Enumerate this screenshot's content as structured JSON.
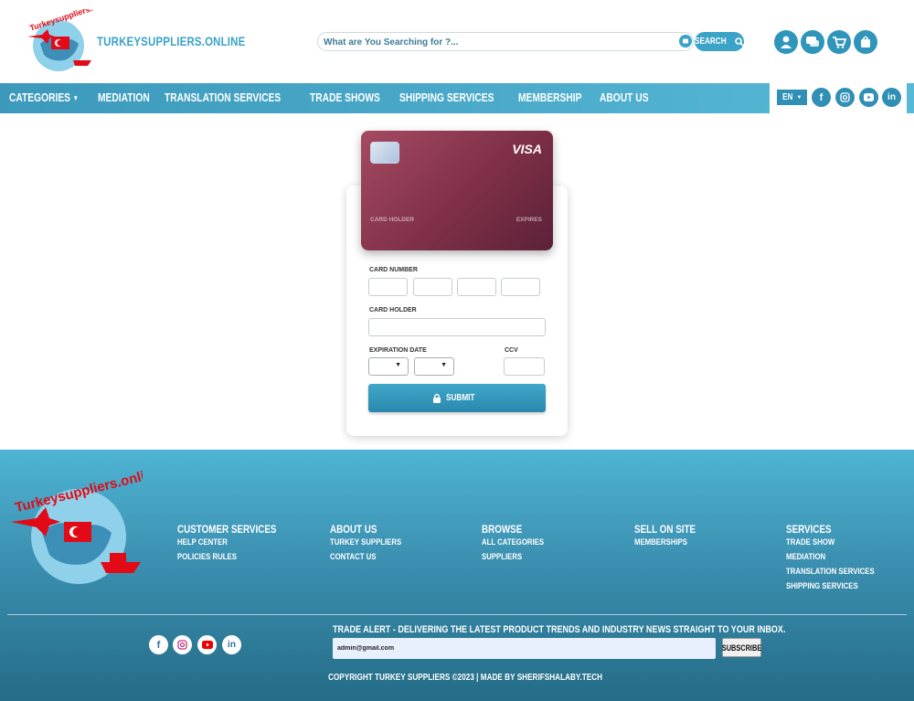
{
  "header": {
    "brand": "TURKEYSUPPLIERS.ONLINE",
    "logo_text": "Turkeysuppliers.online",
    "search_placeholder": "What are You Searching for ?...",
    "search_button": "SEARCH",
    "icons": [
      "user-icon",
      "chat-icon",
      "cart-icon",
      "shopping-bag-icon"
    ]
  },
  "nav": {
    "items": [
      "CATEGORIES",
      "MEDIATION",
      "TRANSLATION SERVICES",
      "TRADE SHOWS",
      "SHIPPING SERVICES",
      "MEMBERSHIP",
      "ABOUT US"
    ],
    "language": "EN",
    "social": [
      "facebook-icon",
      "instagram-icon",
      "youtube-icon",
      "linkedin-icon"
    ]
  },
  "card": {
    "brand": "VISA",
    "holder_label": "CARD HOLDER",
    "expires_label": "EXPIRES"
  },
  "form": {
    "card_number_label": "CARD NUMBER",
    "card_holder_label": "CARD HOLDER",
    "expiration_label": "EXPIRATION DATE",
    "ccv_label": "CCV",
    "submit_label": "SUBMIT"
  },
  "footer": {
    "logo_text": "Turkeysuppliers.online",
    "columns": [
      {
        "title": "CUSTOMER SERVICES",
        "links": [
          "HELP CENTER",
          "POLICIES RULES"
        ]
      },
      {
        "title": "ABOUT US",
        "links": [
          "TURKEY SUPPLIERS",
          "CONTACT US"
        ]
      },
      {
        "title": "BROWSE",
        "links": [
          "ALL CATEGORIES",
          "SUPPLIERS"
        ]
      },
      {
        "title": "SELL ON SITE",
        "links": [
          "MEMBERSHIPS"
        ]
      },
      {
        "title": "SERVICES",
        "links": [
          "TRADE SHOW",
          "MEDIATION",
          "TRANSLATION SERVICES",
          "SHIPPING SERVICES"
        ]
      }
    ],
    "trade_alert": "TRADE ALERT - DELIVERING THE LATEST PRODUCT TRENDS AND INDUSTRY NEWS STRAIGHT TO YOUR INBOX.",
    "email_value": "admin@gmail.com",
    "subscribe_label": "SUBSCRIBE",
    "copyright": "COPYRIGHT TURKEY SUPPLIERS ©2023 | MADE BY SHERIFSHALABY.TECH",
    "social": [
      "facebook-icon",
      "instagram-icon",
      "youtube-icon",
      "linkedin-icon"
    ]
  },
  "colors": {
    "accent": "#3aa3c7",
    "nav": "#4aa9cb",
    "card_gradient_start": "#a54a62",
    "card_gradient_end": "#5c2238",
    "footer_top": "#4fb4d3",
    "footer_bottom": "#246c87"
  }
}
